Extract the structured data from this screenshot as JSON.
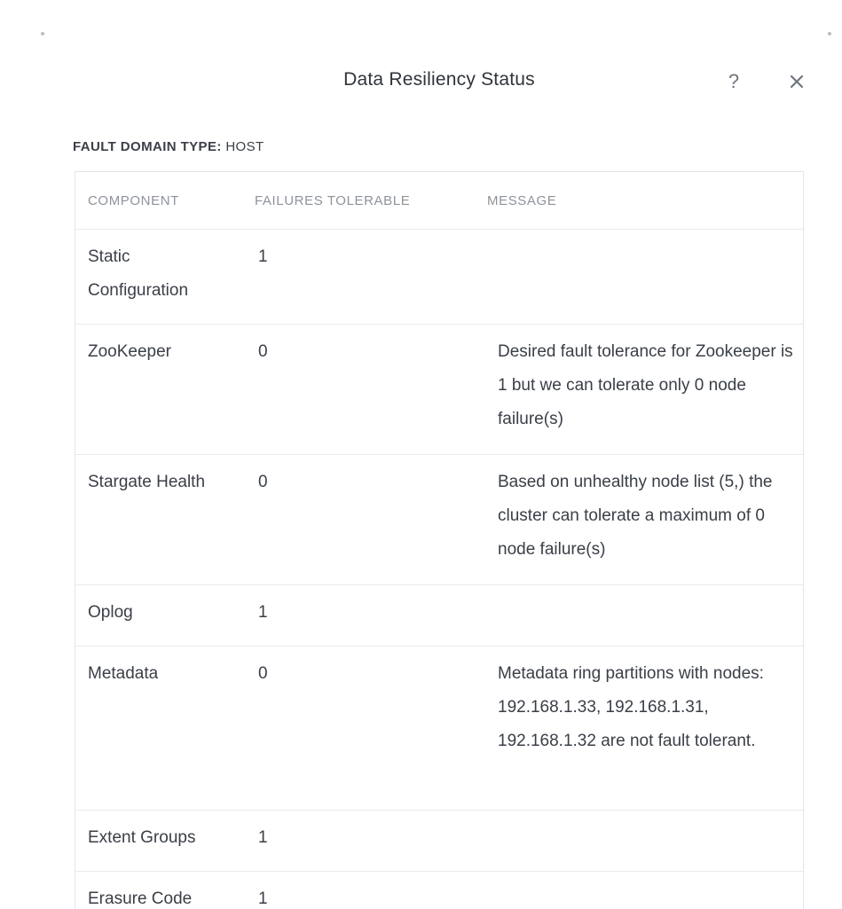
{
  "dialog": {
    "title": "Data Resiliency Status",
    "help_icon": "question-mark-icon",
    "help_glyph": "?",
    "close_icon": "close-icon"
  },
  "fault_domain": {
    "label": "FAULT DOMAIN TYPE:",
    "value": "HOST"
  },
  "table": {
    "headers": [
      "COMPONENT",
      "FAILURES TOLERABLE",
      "MESSAGE"
    ],
    "rows": [
      {
        "component": "Static Configuration",
        "failures": "1",
        "message": ""
      },
      {
        "component": "ZooKeeper",
        "failures": "0",
        "message": "Desired fault tolerance for Zookeeper is 1 but we can tolerate only 0 node failure(s)"
      },
      {
        "component": "Stargate Health",
        "failures": "0",
        "message": "Based on unhealthy node list (5,) the cluster can tolerate a maximum of 0 node failure(s)"
      },
      {
        "component": "Oplog",
        "failures": "1",
        "message": ""
      },
      {
        "component": "Metadata",
        "failures": "0",
        "message": "Metadata ring partitions with nodes: 192.168.1.33, 192.168.1.31, 192.168.1.32 are not fault tolerant."
      },
      {
        "component": "Extent Groups",
        "failures": "1",
        "message": ""
      },
      {
        "component": "Erasure Code",
        "failures": "1",
        "message": ""
      }
    ]
  },
  "colors": {
    "text": "#3a3f47",
    "header_text": "#8d939b",
    "border": "#e2e5ea",
    "icon": "#6f757e"
  }
}
